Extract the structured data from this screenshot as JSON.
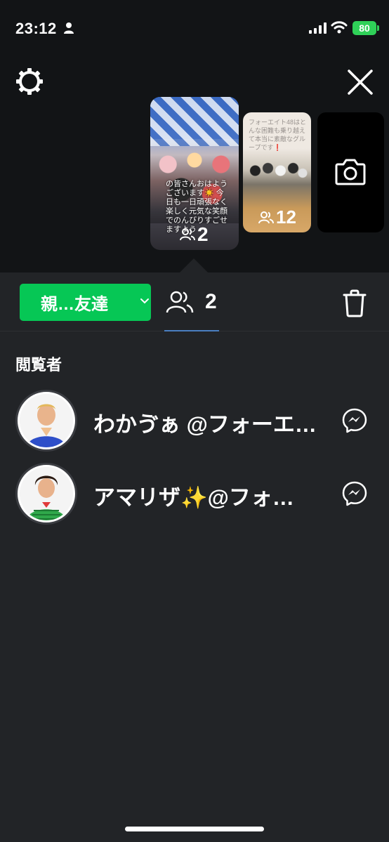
{
  "status_bar": {
    "time": "23:12",
    "battery": "80"
  },
  "story_thumbnails": [
    {
      "overlay_text": "の皆さんおはようございます☀️ 今日も一日頑張なく楽しく元気な笑顔でのんびりすごせますよう",
      "viewer_count": "2"
    },
    {
      "overlay_text": "フォーエイト48はとんな困難も乗り越えて本当に素敵なグループです❗️",
      "viewer_count": "12"
    }
  ],
  "toolbar": {
    "privacy_label": "親…友達",
    "viewer_count": "2"
  },
  "viewers_section": {
    "title": "閲覧者",
    "viewers": [
      {
        "name": "わかゔぁ @フォーエ…"
      },
      {
        "name": "アマリザ✨@フォ…"
      }
    ]
  },
  "colors": {
    "accent_green": "#06c755",
    "background": "#222427",
    "top_background": "#121416",
    "tab_underline": "#4a7fc0"
  },
  "icons": [
    "person-icon",
    "signal-icon",
    "wifi-icon",
    "gear-icon",
    "close-icon",
    "people-icon",
    "camera-icon",
    "chevron-down-icon",
    "trash-icon",
    "messenger-icon"
  ]
}
